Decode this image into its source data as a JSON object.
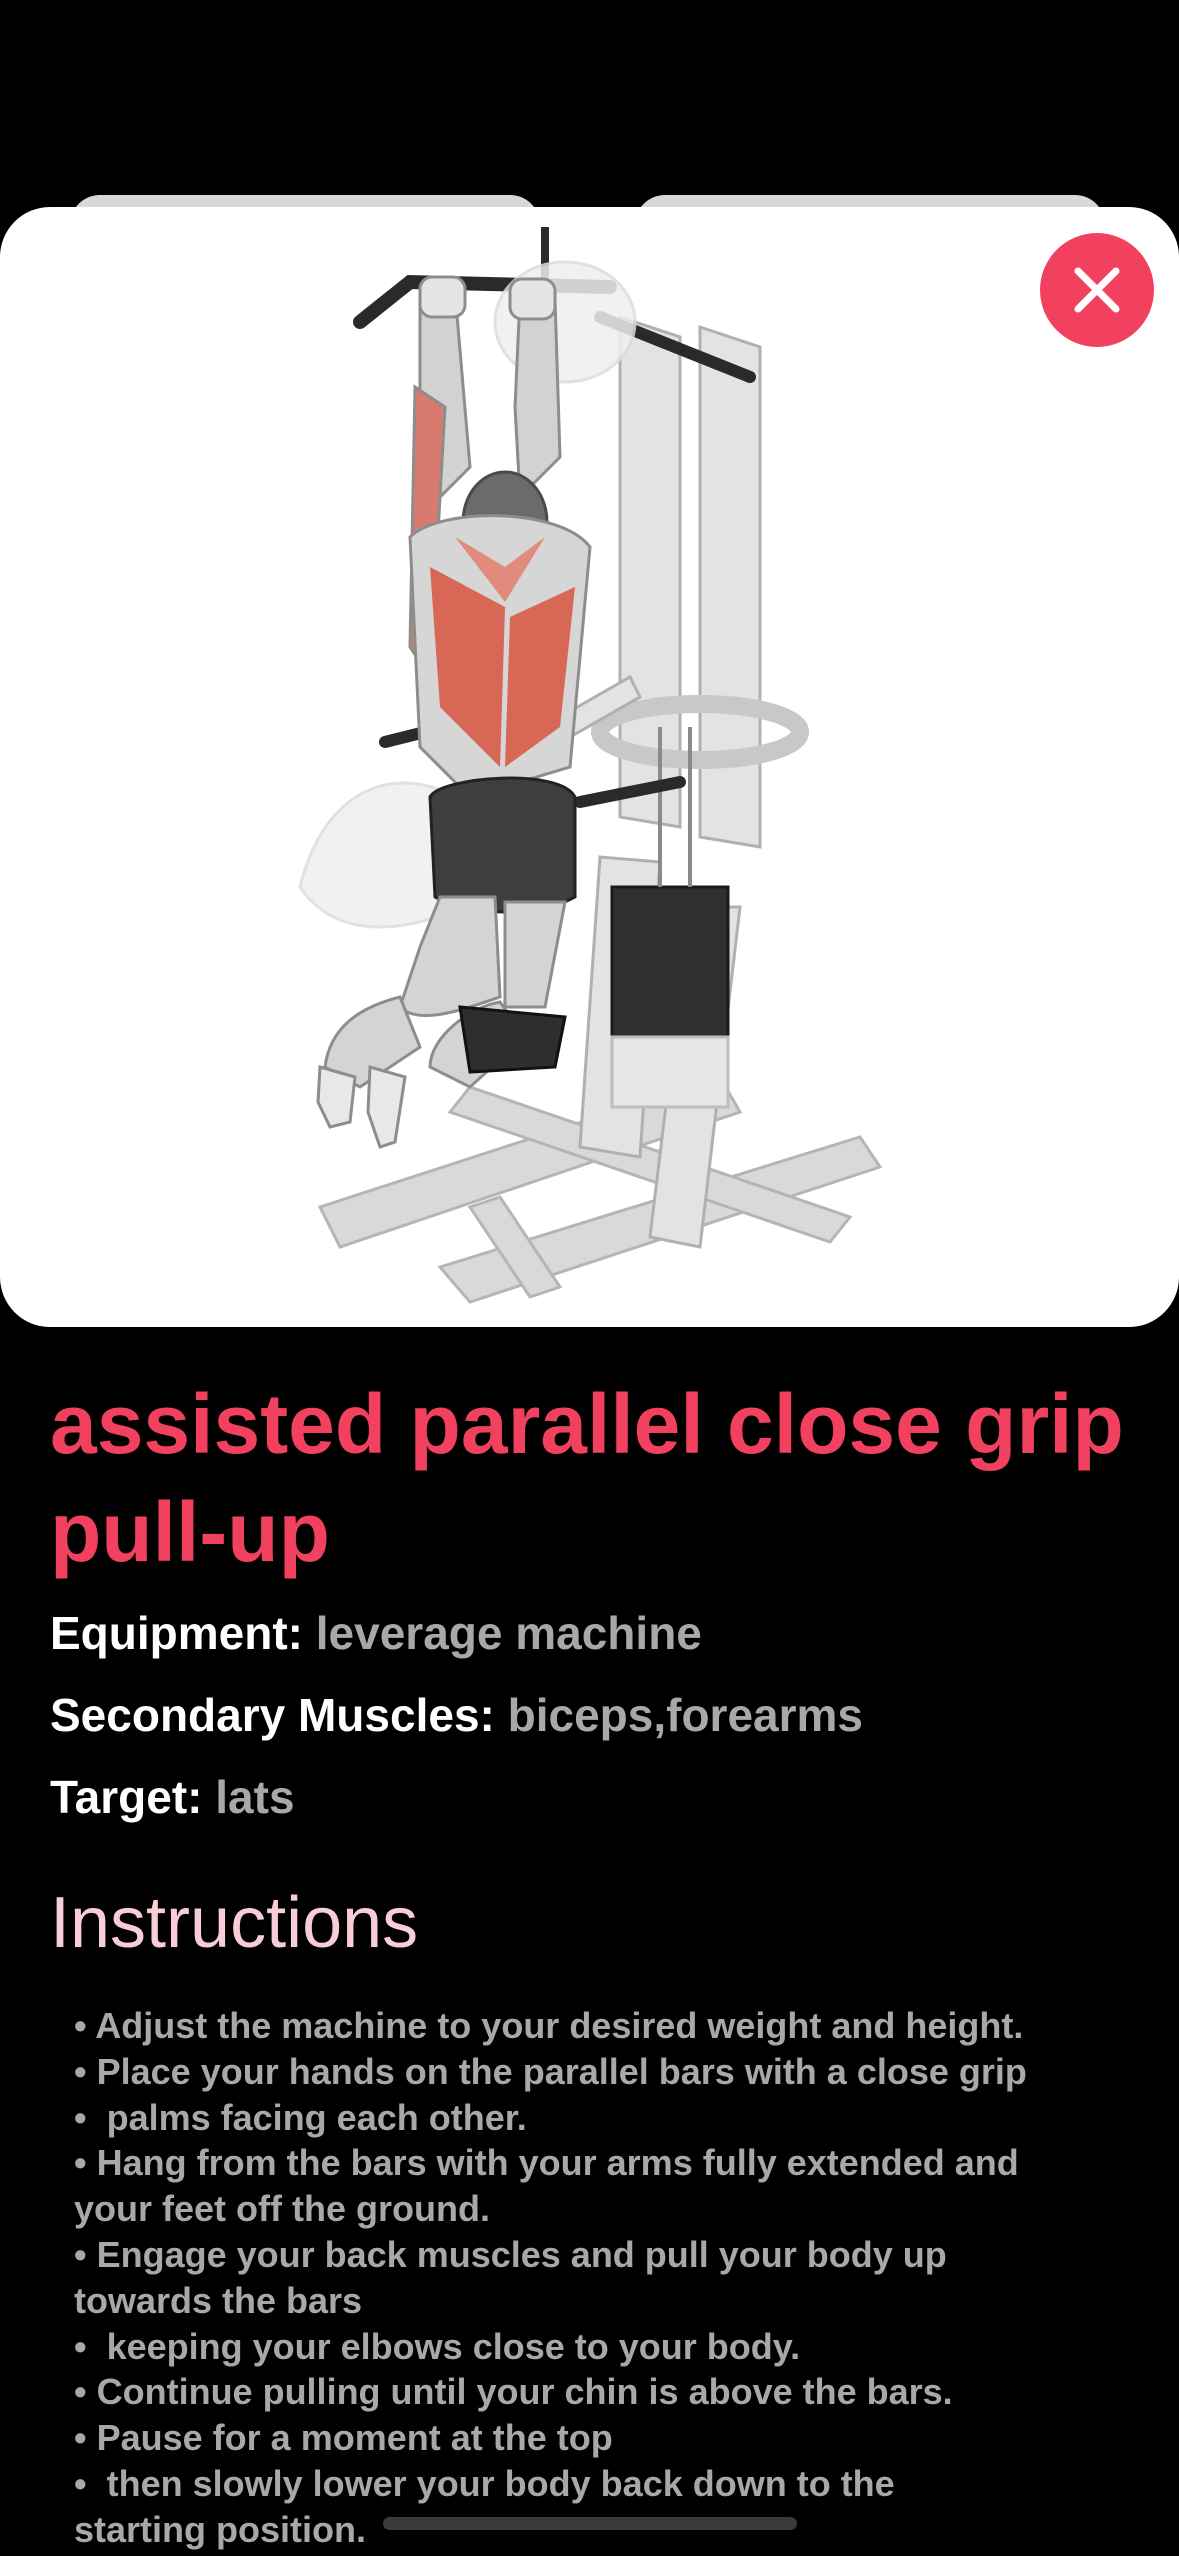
{
  "exercise": {
    "name": "assisted parallel close grip pull-up",
    "image_icon": "exercise-illustration",
    "close_icon": "close-icon"
  },
  "details": {
    "equipment": {
      "label": "Equipment:",
      "value": "leverage machine"
    },
    "secondary_muscles": {
      "label": "Secondary Muscles:",
      "value": "biceps,forearms"
    },
    "target": {
      "label": "Target:",
      "value": "lats"
    }
  },
  "instructions": {
    "title": "Instructions",
    "text": "• Adjust the machine to your desired weight and height.\n• Place your hands on the parallel bars with a close grip\n•  palms facing each other.\n• Hang from the bars with your arms fully extended and\nyour feet off the ground.\n• Engage your back muscles and pull your body up\ntowards the bars\n•  keeping your elbows close to your body.\n• Continue pulling until your chin is above the bars.\n• Pause for a moment at the top\n•  then slowly lower your body back down to the\nstarting position."
  },
  "colors": {
    "accent": "#f2415f",
    "section_title": "#f8cdd6",
    "muted_text": "#a8a8a8",
    "background": "#000000"
  }
}
